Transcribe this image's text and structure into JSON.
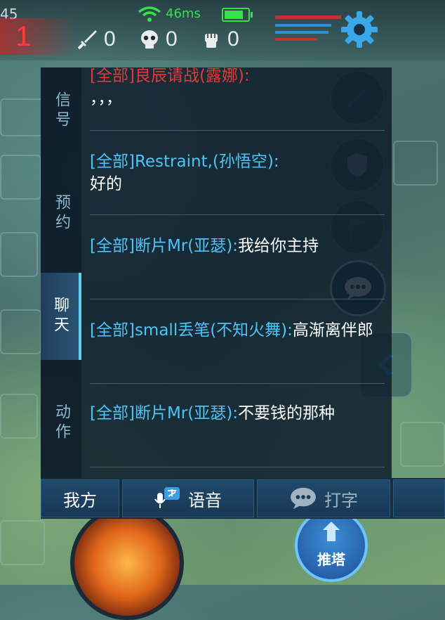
{
  "hud": {
    "timer_fragment": "45",
    "team_score": "1",
    "ping": "46ms",
    "battery_level": 0.8,
    "stats": [
      {
        "icon": "sword-icon",
        "value": "0"
      },
      {
        "icon": "skull-icon",
        "value": "0"
      },
      {
        "icon": "fist-icon",
        "value": "0"
      }
    ],
    "settings_icon": "gear-icon"
  },
  "chat_panel": {
    "tabs": [
      {
        "label": "信号",
        "active": false
      },
      {
        "label": "预约",
        "active": false
      },
      {
        "label": "聊天",
        "active": true
      },
      {
        "label": "动作",
        "active": false
      }
    ],
    "messages": [
      {
        "prefix": "[全部]良辰请战(露娜):",
        "text": "，，，",
        "team": "enemy"
      },
      {
        "prefix": "[全部]Restraint,(孙悟空):",
        "text": "好的",
        "team": "ally"
      },
      {
        "prefix": "[全部]断片Mr(亚瑟):",
        "text": "我给你主持",
        "team": "ally"
      },
      {
        "prefix": "[全部]small丢笔(不知火舞):",
        "text": "高渐离伴郎",
        "team": "ally"
      },
      {
        "prefix": "[全部]断片Mr(亚瑟):",
        "text": "不要钱的那种",
        "team": "ally"
      }
    ]
  },
  "bottom_bar": {
    "team_label": "我方",
    "voice_label": "语音",
    "type_label": "打字"
  },
  "skills": {
    "push_tower_label": "推塔"
  },
  "colors": {
    "ally_name": "#4fc3f7",
    "enemy_name": "#e53935",
    "ping_green": "#35e04a",
    "panel_bg": "#0e1e2c"
  }
}
